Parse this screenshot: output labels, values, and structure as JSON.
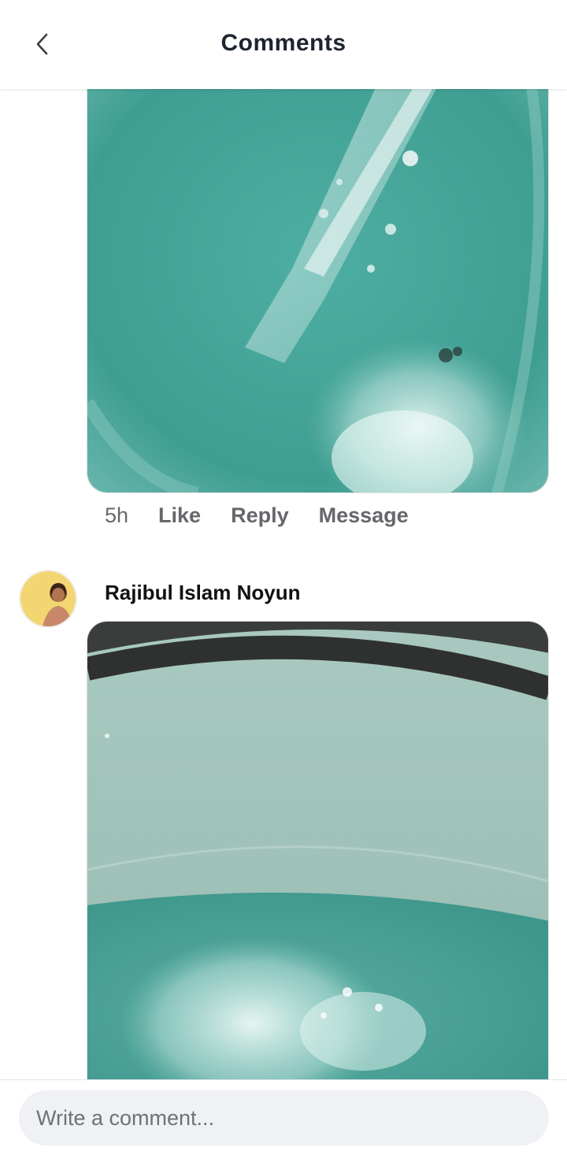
{
  "header": {
    "title": "Comments",
    "back_icon": "chevron-left-icon"
  },
  "comments": [
    {
      "time": "5h",
      "actions": [
        "Like",
        "Reply",
        "Message"
      ],
      "media_icon": "photo"
    },
    {
      "author": "Rajibul Islam Noyun",
      "media_icon": "photo"
    }
  ],
  "composer": {
    "placeholder": "Write a comment..."
  },
  "colors": {
    "title": "#1d2530",
    "meta": "#65676b",
    "input_bg": "#f0f1f4"
  }
}
